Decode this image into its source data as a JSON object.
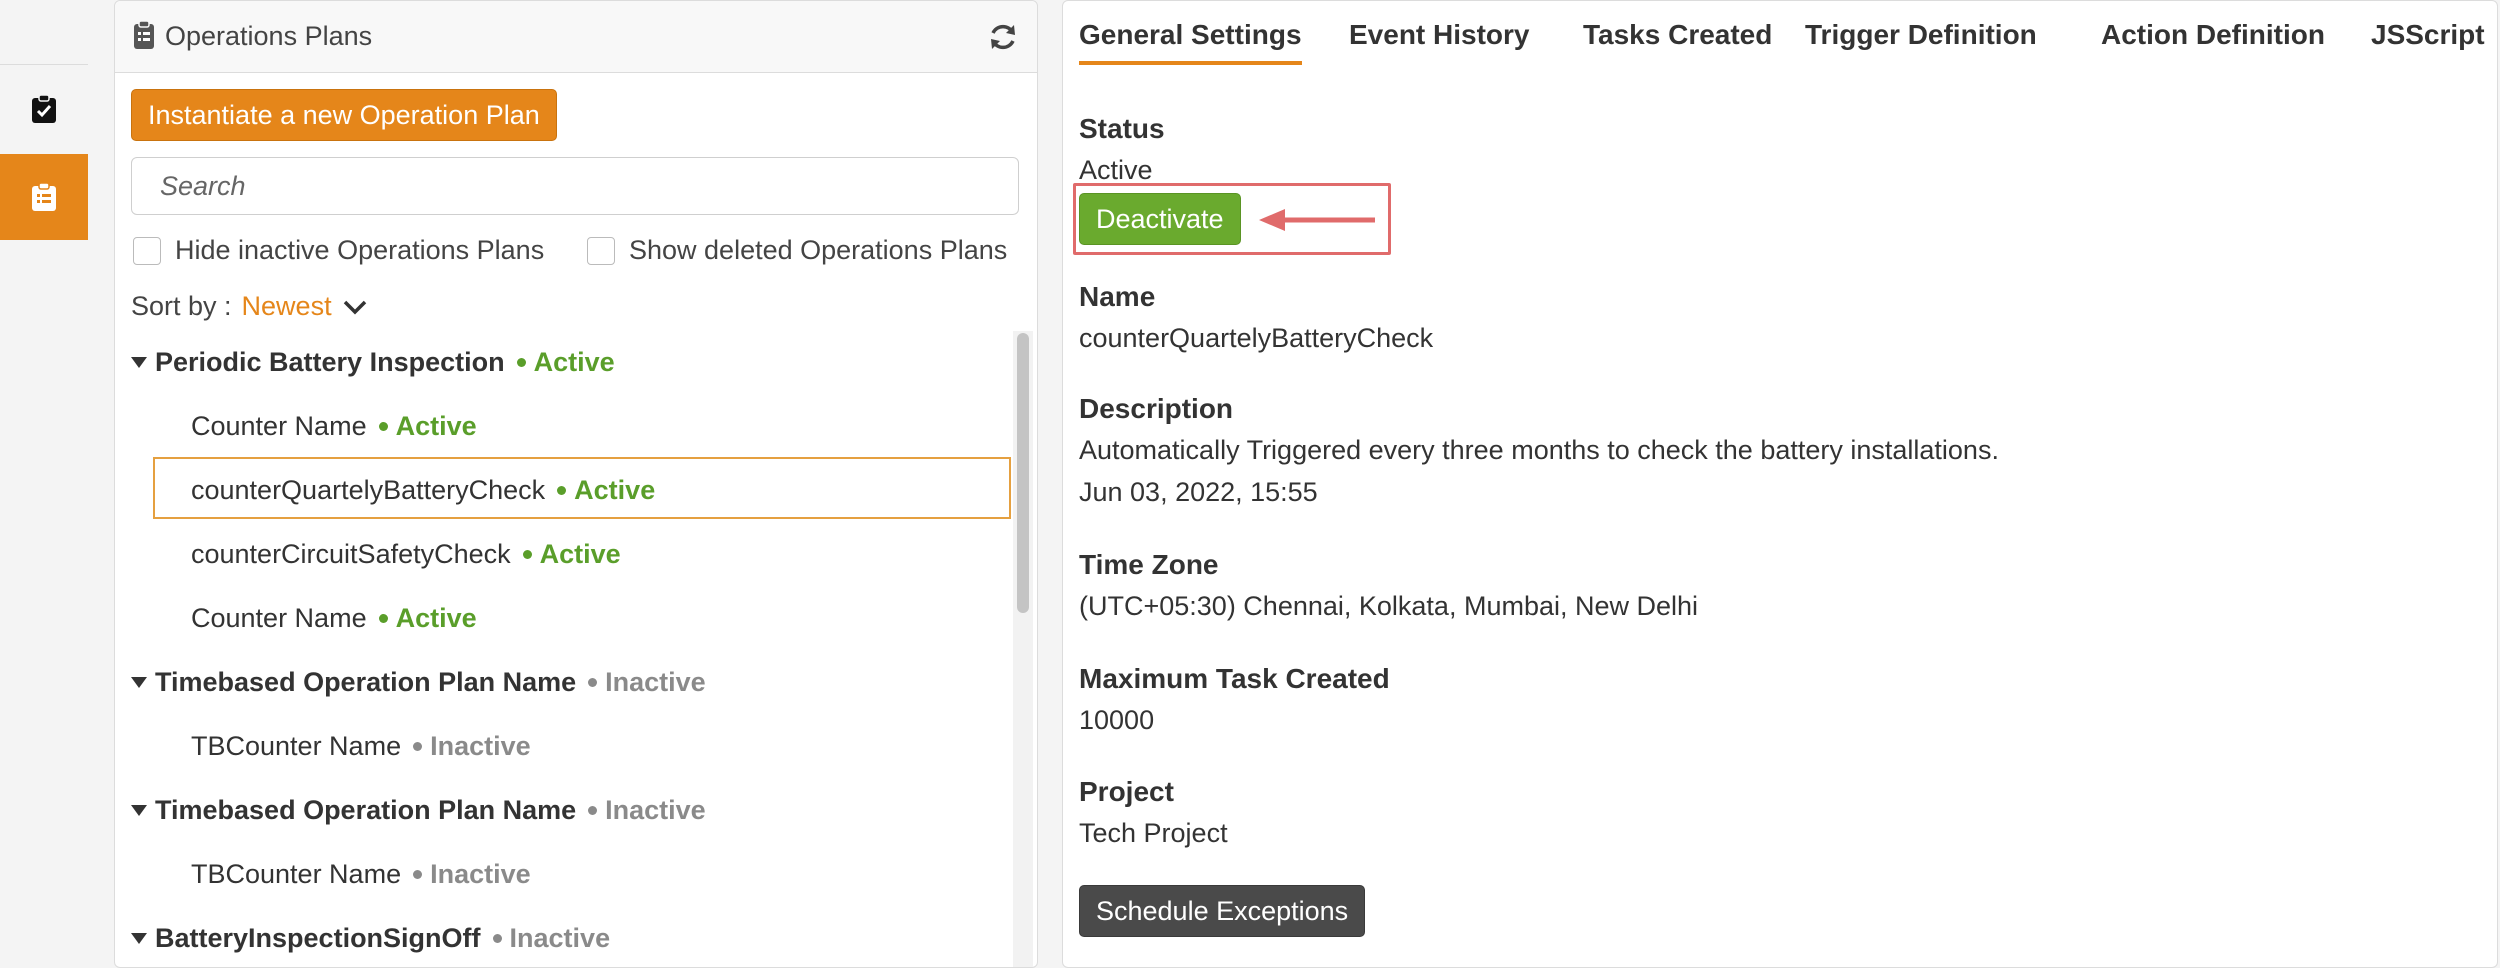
{
  "left_panel": {
    "title": "Operations Plans",
    "new_button_label": "Instantiate a new Operation Plan",
    "search_placeholder": "Search",
    "hide_inactive_label": "Hide inactive Operations Plans",
    "show_deleted_label": "Show deleted Operations Plans",
    "sort_label": "Sort by :",
    "sort_value": "Newest",
    "tree": [
      {
        "kind": "parent",
        "name": "Periodic Battery Inspection",
        "status": "Active"
      },
      {
        "kind": "child",
        "name": "Counter Name",
        "status": "Active"
      },
      {
        "kind": "child",
        "name": "counterQuartelyBatteryCheck",
        "status": "Active",
        "selected": true
      },
      {
        "kind": "child",
        "name": "counterCircuitSafetyCheck",
        "status": "Active"
      },
      {
        "kind": "child",
        "name": "Counter Name",
        "status": "Active"
      },
      {
        "kind": "parent",
        "name": "Timebased Operation Plan Name",
        "status": "Inactive"
      },
      {
        "kind": "child",
        "name": "TBCounter Name",
        "status": "Inactive"
      },
      {
        "kind": "parent",
        "name": "Timebased Operation Plan Name",
        "status": "Inactive"
      },
      {
        "kind": "child",
        "name": "TBCounter Name",
        "status": "Inactive"
      },
      {
        "kind": "parent",
        "name": "BatteryInspectionSignOff",
        "status": "Inactive"
      }
    ]
  },
  "tabs": [
    "General Settings",
    "Event History",
    "Tasks Created",
    "Trigger Definition",
    "Action Definition",
    "JSScript"
  ],
  "details": {
    "status_label": "Status",
    "status_value": "Active",
    "deactivate_label": "Deactivate",
    "name_label": "Name",
    "name_value": "counterQuartelyBatteryCheck",
    "description_label": "Description",
    "description_value": "Automatically Triggered every three months to check the battery installations.",
    "description_date": "Jun 03, 2022, 15:55",
    "timezone_label": "Time Zone",
    "timezone_value": "(UTC+05:30) Chennai, Kolkata, Mumbai, New Delhi",
    "max_task_label": "Maximum Task Created",
    "max_task_value": "10000",
    "project_label": "Project",
    "project_value": "Tech Project",
    "schedule_exceptions_label": "Schedule Exceptions"
  },
  "colors": {
    "accent_orange": "#e5861a",
    "active_green": "#5a9e2a",
    "deactivate_green": "#6aaa2e",
    "inactive_gray": "#8a8a8a",
    "annotation_red": "#e06b6b"
  }
}
